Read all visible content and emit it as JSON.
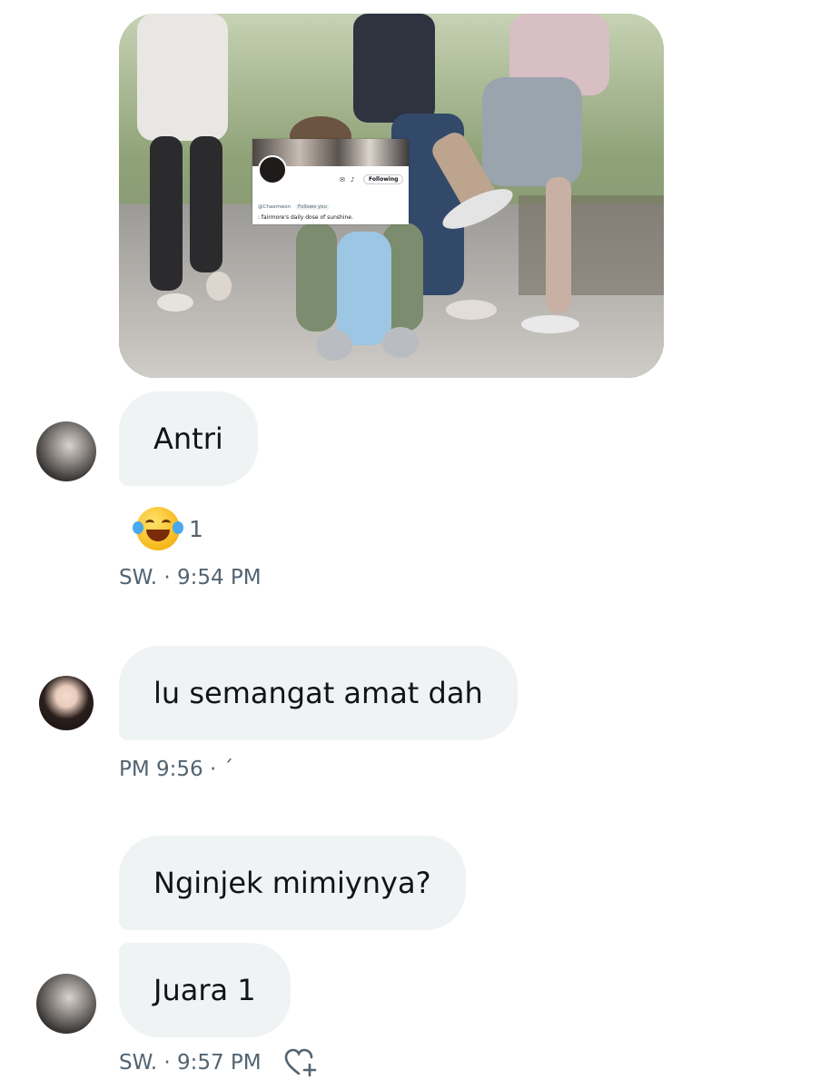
{
  "messages": [
    {
      "type": "image",
      "profile_card": {
        "following_label": "Following",
        "handle": "@Chaemwon",
        "follows_you": "Follows you",
        "bio": ": fairmore's daily dose of sunshine."
      }
    },
    {
      "text": "Antri",
      "reaction_count": "1",
      "meta": "SW. · 9:54 PM"
    },
    {
      "text": "lu semangat amat dah",
      "meta": "PM 9:56 · ´"
    },
    {
      "text": "Nginjek mimiynya?"
    },
    {
      "text": "Juara 1",
      "meta": "SW. · 9:57 PM"
    }
  ],
  "icons": {
    "reaction": "tears-of-joy-emoji",
    "add_reaction": "heart-plus-icon"
  }
}
